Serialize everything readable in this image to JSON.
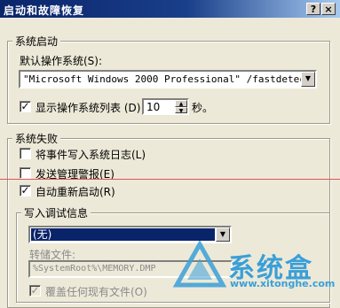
{
  "window": {
    "title": "启动和故障恢复",
    "help_label": "?",
    "close_label": "×"
  },
  "system_startup": {
    "group_label": "系统启动",
    "default_os_label": "默认操作系统(S):",
    "default_os_value": "\"Microsoft Windows 2000 Professional\" /fastdetect",
    "show_list_label": "显示操作系统列表",
    "show_list_key": "(D)",
    "show_list_checked": true,
    "seconds_value": "10",
    "seconds_unit": "秒。"
  },
  "system_failure": {
    "group_label": "系统失败",
    "write_event_label": "将事件写入系统日志(L)",
    "write_event_checked": false,
    "send_alert_label": "发送管理警报(E)",
    "send_alert_checked": false,
    "auto_restart_label": "自动重新启动(R)",
    "auto_restart_checked": true
  },
  "debug_info": {
    "group_label": "写入调试信息",
    "dump_type_value": "(无)",
    "dump_file_label": "转储文件:",
    "dump_file_value": "%SystemRoot%\\MEMORY.DMP",
    "overwrite_label": "覆盖任何现有文件(O)",
    "overwrite_checked": true
  },
  "watermark": {
    "brand": "系统盒",
    "url": "www.xitonghe.com"
  },
  "colors": {
    "title_start": "#0a246a",
    "title_end": "#a6caf0",
    "dialog_bg": "#ece9d8",
    "selection": "#0a246a",
    "watermark": "#3a9fd8"
  }
}
